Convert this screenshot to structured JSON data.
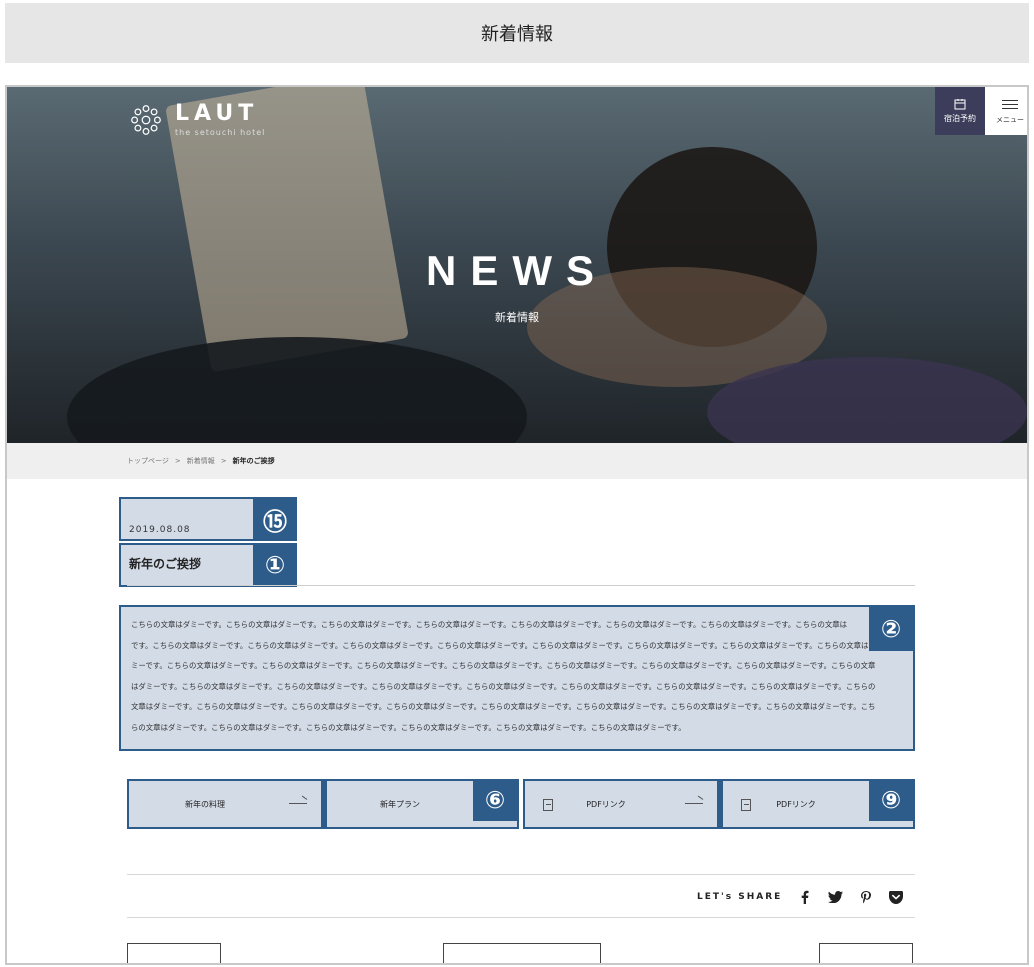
{
  "page_title": "新着情報",
  "logo": {
    "name": "LAUT",
    "subtitle": "the setouchi hotel"
  },
  "header": {
    "reserve_label": "宿泊予約",
    "menu_label": "メニュー"
  },
  "hero": {
    "title": "NEWS",
    "subtitle": "新着情報"
  },
  "breadcrumb": {
    "items": [
      "トップページ",
      "新着情報",
      "新年のご挨拶"
    ],
    "separator": ">"
  },
  "article": {
    "date": "2019.08.08",
    "title": "新年のご挨拶",
    "body_lines": [
      "こちらの文章はダミーです。こちらの文章はダミーです。こちらの文章はダミーです。こちらの文章はダミーです。こちらの文章はダミーです。こちらの文章はダミーです。こちらの文章はダミーです。こちらの文章は",
      "です。こちらの文章はダミーです。こちらの文章はダミーです。こちらの文章はダミーです。こちらの文章はダミーです。こちらの文章はダミーです。こちらの文章はダミーです。こちらの文章はダミーです。こちらの文章はダミー",
      "ミーです。こちらの文章はダミーです。こちらの文章はダミーです。こちらの文章はダミーです。こちらの文章はダミーです。こちらの文章はダミーです。こちらの文章はダミーです。こちらの文章はダミーです。こちらの文章",
      "はダミーです。こちらの文章はダミーです。こちらの文章はダミーです。こちらの文章はダミーです。こちらの文章はダミーです。こちらの文章はダミーです。こちらの文章はダミーです。こちらの文章はダミーです。こちらの",
      "文章はダミーです。こちらの文章はダミーです。こちらの文章はダミーです。こちらの文章はダミーです。こちらの文章はダミーです。こちらの文章はダミーです。こちらの文章はダミーです。こちらの文章はダミーです。こち",
      "らの文章はダミーです。こちらの文章はダミーです。こちらの文章はダミーです。こちらの文章はダミーです。こちらの文章はダミーです。こちらの文章はダミーです。"
    ]
  },
  "annotations": {
    "date_badge": "⑮",
    "title_badge": "①",
    "body_badge": "②",
    "links_badge_1": "⑥",
    "links_badge_2": "⑨"
  },
  "links": [
    {
      "label": "新年の料理",
      "icon": "arrow-right-icon"
    },
    {
      "label": "新年プラン",
      "icon": ""
    },
    {
      "label": "PDFリンク",
      "icon": "pdf-icon"
    },
    {
      "label": "PDFリンク",
      "icon": "pdf-icon"
    }
  ],
  "share": {
    "label": "LET's SHARE",
    "icons": [
      "facebook-icon",
      "twitter-icon",
      "pinterest-icon",
      "pocket-icon"
    ]
  },
  "colors": {
    "annotation_blue": "#2e5c8a",
    "annotation_fill": "#d3dbe7",
    "reserve_bg": "#3c3d5a"
  }
}
